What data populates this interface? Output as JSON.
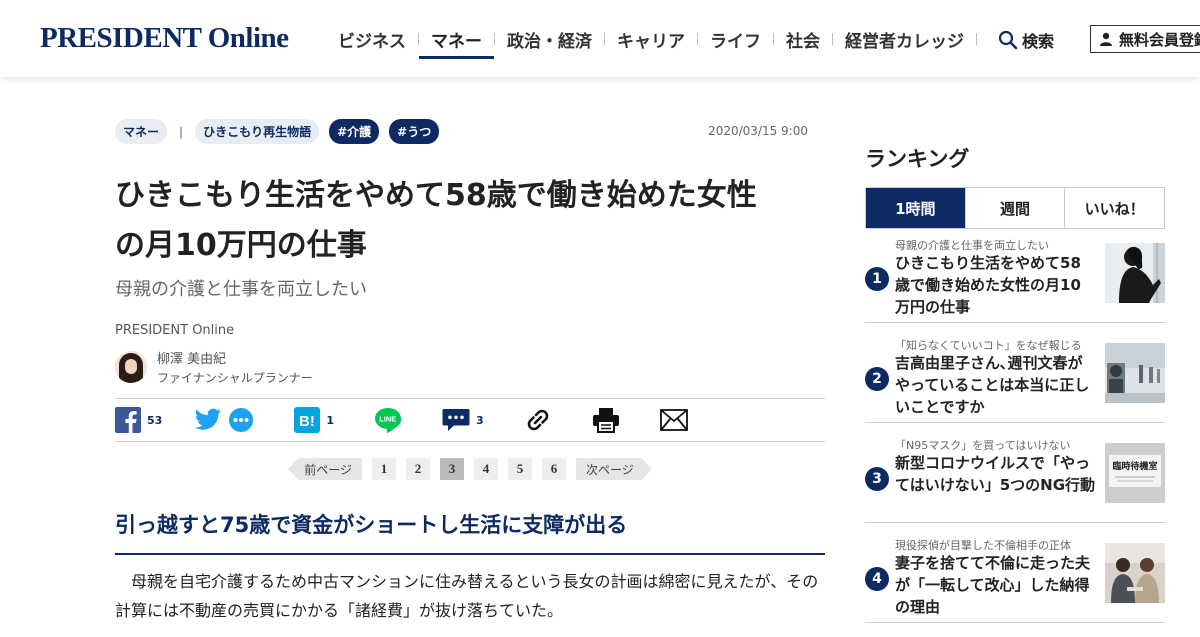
{
  "header": {
    "logo": "PRESIDENT Online",
    "nav": [
      "ビジネス",
      "マネー",
      "政治・経済",
      "キャリア",
      "ライフ",
      "社会",
      "経営者カレッジ"
    ],
    "active_nav": "マネー",
    "search_label": "検索",
    "register_label": "無料会員登録"
  },
  "article": {
    "category": "マネー",
    "series": "ひきこもり再生物語",
    "tags": [
      "#介護",
      "#うつ"
    ],
    "date": "2020/03/15 9:00",
    "title_line1": "ひきこもり生活をやめて58歳で働き始めた女性",
    "title_line2": "の月10万円の仕事",
    "subtitle": "母親の介護と仕事を両立したい",
    "source": "PRESIDENT Online",
    "author_name": "柳澤 美由紀",
    "author_title": "ファイナンシャルプランナー",
    "share": {
      "facebook_count": "53",
      "hatena_count": "1",
      "comment_count": "3"
    },
    "pager": {
      "prev": "前ページ",
      "next": "次ページ",
      "pages": [
        "1",
        "2",
        "3",
        "4",
        "5",
        "6"
      ],
      "current": "3"
    },
    "section_heading": "引っ越すと75歳で資金がショートし生活に支障が出る",
    "body": "　母親を自宅介護するため中古マンションに住み替えるという長女の計画は綿密に見えたが、その計算には不動産の売買にかかる「諸経費」が抜け落ちていた。"
  },
  "ranking": {
    "heading": "ランキング",
    "tabs": [
      "1時間",
      "週間",
      "いいね！"
    ],
    "active_tab": "1時間",
    "items": [
      {
        "no": "1",
        "kicker": "母親の介護と仕事を両立したい",
        "title": "ひきこもり生活をやめて58歳で働き始めた女性の月10万円の仕事",
        "thumb": "silhouette-photo"
      },
      {
        "no": "2",
        "kicker": "「知らなくていいコト」をなぜ報じる",
        "title": "吉高由里子さん､週刊文春がやっていることは本当に正しいことですか",
        "thumb": "street-photo"
      },
      {
        "no": "3",
        "kicker": "「N95マスク」を買ってはいけない",
        "title": "新型コロナウイルスで「やってはいけない」5つのNG行動",
        "thumb": "sign-photo",
        "thumb_text": "臨時待機室"
      },
      {
        "no": "4",
        "kicker": "現役探偵が目撃した不倫相手の正体",
        "title": "妻子を捨てて不倫に走った夫が「一転して改心」した納得の理由",
        "thumb": "couple-photo"
      }
    ]
  },
  "colors": {
    "brand": "#0d2a63",
    "facebook": "#3b5998",
    "twitter": "#1da1f2",
    "hatena": "#00a4de",
    "line": "#06c755"
  }
}
